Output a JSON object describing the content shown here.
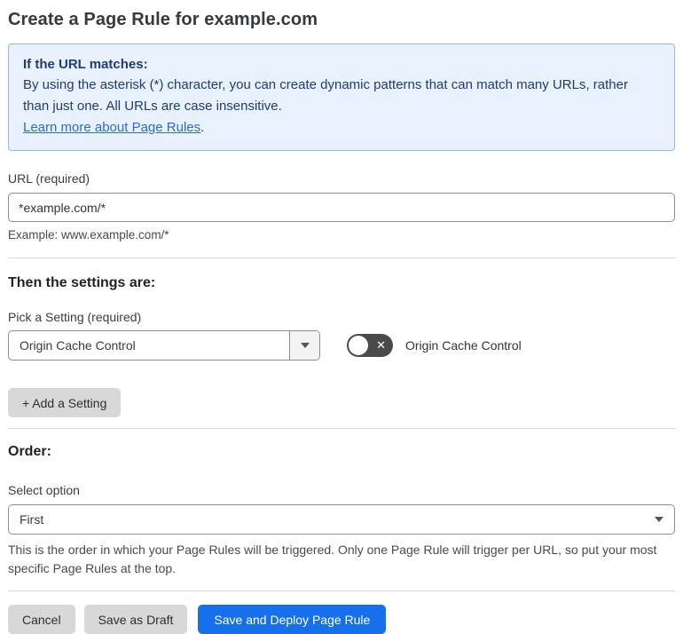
{
  "page": {
    "title": "Create a Page Rule for example.com"
  },
  "info_box": {
    "heading": "If the URL matches:",
    "body": "By using the asterisk (*) character, you can create dynamic patterns that can match many URLs, rather than just one. All URLs are case insensitive.",
    "link_label": "Learn more about Page Rules",
    "link_suffix": "."
  },
  "url_field": {
    "label": "URL (required)",
    "value": "*example.com/*",
    "helper": "Example: www.example.com/*"
  },
  "settings_section": {
    "heading": "Then the settings are:",
    "picker_label": "Pick a Setting (required)",
    "picker_value": "Origin Cache Control",
    "toggle_label": "Origin Cache Control",
    "toggle_state": "off",
    "toggle_x_glyph": "✕",
    "add_button_label": "+ Add a Setting"
  },
  "order_section": {
    "heading": "Order:",
    "select_label": "Select option",
    "select_value": "First",
    "helper": "This is the order in which your Page Rules will be triggered. Only one Page Rule will trigger per URL, so put your most specific Page Rules at the top."
  },
  "footer": {
    "cancel_label": "Cancel",
    "save_draft_label": "Save as Draft",
    "save_deploy_label": "Save and Deploy Page Rule"
  },
  "colors": {
    "info_bg": "#e9f2fc",
    "info_border": "#8fbbe8",
    "info_text": "#1d3c78",
    "link": "#2a6bd4",
    "primary_button": "#1670ec",
    "toggle_off_bg": "#4a4a4a"
  }
}
